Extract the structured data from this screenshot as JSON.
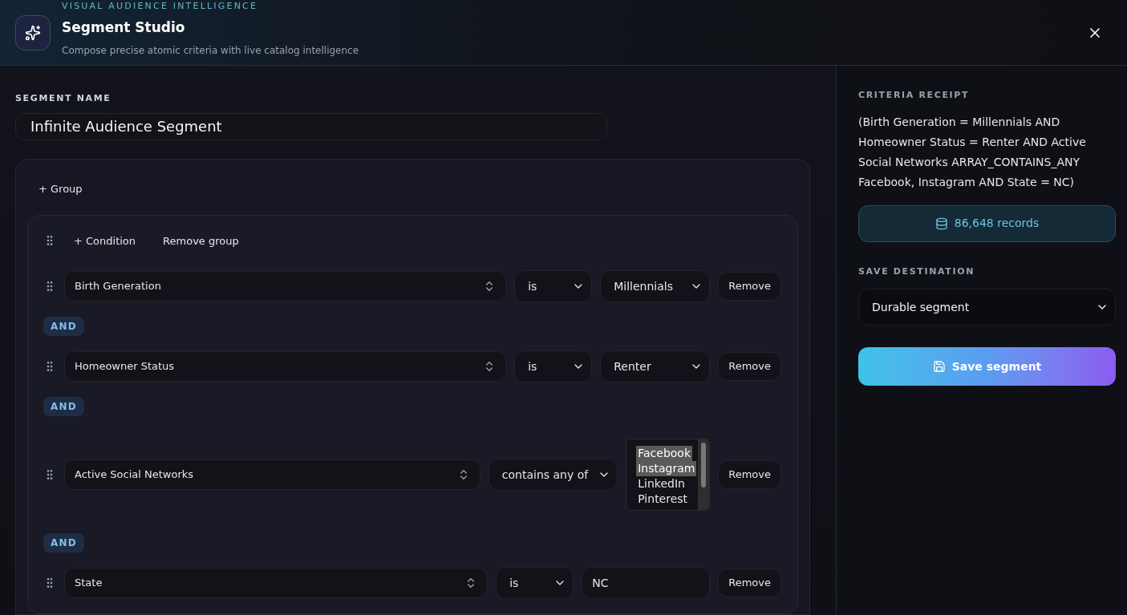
{
  "header": {
    "eyebrow": "VISUAL AUDIENCE INTELLIGENCE",
    "title": "Segment Studio",
    "subtitle": "Compose precise atomic criteria with live catalog intelligence"
  },
  "segment_name": {
    "label": "SEGMENT NAME",
    "value": "Infinite Audience Segment"
  },
  "builder": {
    "add_group": "+ Group",
    "group": {
      "add_condition": "+ Condition",
      "remove_group": "Remove group",
      "conditions": [
        {
          "field": "Birth Generation",
          "operator": "is",
          "kind": "select",
          "value": "Millennials",
          "remove": "Remove"
        },
        {
          "connector": "AND",
          "field": "Homeowner Status",
          "operator": "is",
          "kind": "select",
          "value": "Renter",
          "remove": "Remove"
        },
        {
          "connector": "AND",
          "field": "Active Social Networks",
          "operator": "contains any of",
          "kind": "multiselect",
          "options": [
            {
              "label": "Facebook",
              "selected": true
            },
            {
              "label": "Instagram",
              "selected": true
            },
            {
              "label": "LinkedIn",
              "selected": false
            },
            {
              "label": "Pinterest",
              "selected": false
            }
          ],
          "remove": "Remove"
        },
        {
          "connector": "AND",
          "field": "State",
          "operator": "is",
          "kind": "text",
          "value": "NC",
          "remove": "Remove"
        }
      ]
    }
  },
  "receipt": {
    "label": "CRITERIA RECEIPT",
    "text": "(Birth Generation = Millennials AND Homeowner Status = Renter AND Active Social Networks ARRAY_CONTAINS_ANY Facebook, Instagram AND State = NC)",
    "count": "86,648 records"
  },
  "save": {
    "label": "SAVE DESTINATION",
    "destination": "Durable segment",
    "button": "Save segment"
  }
}
